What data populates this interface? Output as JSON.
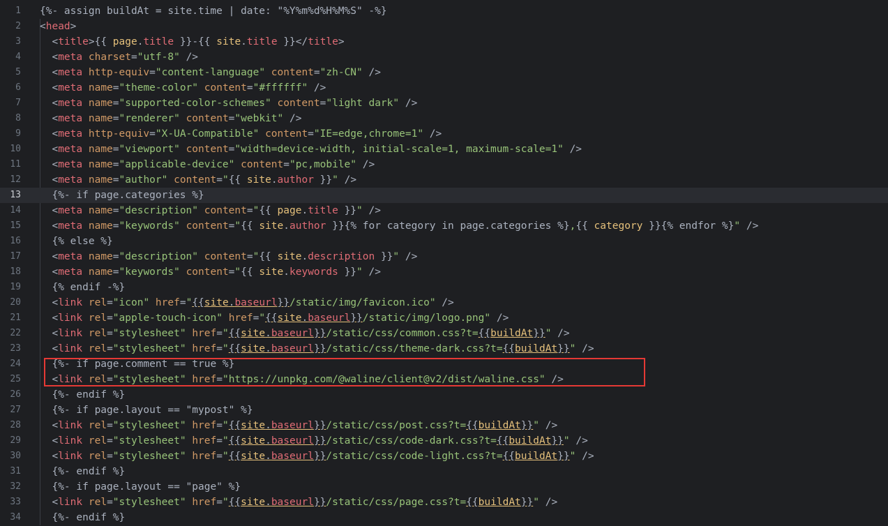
{
  "editor": {
    "current_line": 13,
    "lines": [
      {
        "n": "1",
        "text": "{%- assign buildAt = site.time | date: \"%Y%m%d%H%M%S\" -%}"
      },
      {
        "n": "2",
        "text": "<head>"
      },
      {
        "n": "3",
        "text": "  <title>{{ page.title }}-{{ site.title }}</title>"
      },
      {
        "n": "4",
        "text": "  <meta charset=\"utf-8\" />"
      },
      {
        "n": "5",
        "text": "  <meta http-equiv=\"content-language\" content=\"zh-CN\" />"
      },
      {
        "n": "6",
        "text": "  <meta name=\"theme-color\" content=\"#ffffff\" />"
      },
      {
        "n": "7",
        "text": "  <meta name=\"supported-color-schemes\" content=\"light dark\" />"
      },
      {
        "n": "8",
        "text": "  <meta name=\"renderer\" content=\"webkit\" />"
      },
      {
        "n": "9",
        "text": "  <meta http-equiv=\"X-UA-Compatible\" content=\"IE=edge,chrome=1\" />"
      },
      {
        "n": "10",
        "text": "  <meta name=\"viewport\" content=\"width=device-width, initial-scale=1, maximum-scale=1\" />"
      },
      {
        "n": "11",
        "text": "  <meta name=\"applicable-device\" content=\"pc,mobile\" />"
      },
      {
        "n": "12",
        "text": "  <meta name=\"author\" content=\"{{ site.author }}\" />"
      },
      {
        "n": "13",
        "text": "  {%- if page.categories %}"
      },
      {
        "n": "14",
        "text": "  <meta name=\"description\" content=\"{{ page.title }}\" />"
      },
      {
        "n": "15",
        "text": "  <meta name=\"keywords\" content=\"{{ site.author }}{% for category in page.categories %},{{ category }}{% endfor %}\" />"
      },
      {
        "n": "16",
        "text": "  {% else %}"
      },
      {
        "n": "17",
        "text": "  <meta name=\"description\" content=\"{{ site.description }}\" />"
      },
      {
        "n": "18",
        "text": "  <meta name=\"keywords\" content=\"{{ site.keywords }}\" />"
      },
      {
        "n": "19",
        "text": "  {% endif -%}"
      },
      {
        "n": "20",
        "text": "  <link rel=\"icon\" href=\"{{site.baseurl}}/static/img/favicon.ico\" />"
      },
      {
        "n": "21",
        "text": "  <link rel=\"apple-touch-icon\" href=\"{{site.baseurl}}/static/img/logo.png\" />"
      },
      {
        "n": "22",
        "text": "  <link rel=\"stylesheet\" href=\"{{site.baseurl}}/static/css/common.css?t={{buildAt}}\" />"
      },
      {
        "n": "23",
        "text": "  <link rel=\"stylesheet\" href=\"{{site.baseurl}}/static/css/theme-dark.css?t={{buildAt}}\" />"
      },
      {
        "n": "24",
        "text": "  {%- if page.comment == true %}"
      },
      {
        "n": "25",
        "text": "  <link rel=\"stylesheet\" href=\"https://unpkg.com/@waline/client@v2/dist/waline.css\" />"
      },
      {
        "n": "26",
        "text": "  {%- endif %}"
      },
      {
        "n": "27",
        "text": "  {%- if page.layout == \"mypost\" %}"
      },
      {
        "n": "28",
        "text": "  <link rel=\"stylesheet\" href=\"{{site.baseurl}}/static/css/post.css?t={{buildAt}}\" />"
      },
      {
        "n": "29",
        "text": "  <link rel=\"stylesheet\" href=\"{{site.baseurl}}/static/css/code-dark.css?t={{buildAt}}\" />"
      },
      {
        "n": "30",
        "text": "  <link rel=\"stylesheet\" href=\"{{site.baseurl}}/static/css/code-light.css?t={{buildAt}}\" />"
      },
      {
        "n": "31",
        "text": "  {%- endif %}"
      },
      {
        "n": "32",
        "text": "  {%- if page.layout == \"page\" %}"
      },
      {
        "n": "33",
        "text": "  <link rel=\"stylesheet\" href=\"{{site.baseurl}}/static/css/page.css?t={{buildAt}}\" />"
      },
      {
        "n": "34",
        "text": "  {%- endif %}"
      }
    ]
  },
  "highlight": {
    "color": "#e53935",
    "from_line": 24,
    "to_line": 25
  },
  "colors": {
    "background": "#1e1f22",
    "tag": "#e06c75",
    "attribute": "#d19a66",
    "string": "#98c379",
    "variable": "#e5c07b",
    "text": "#abb2bf"
  }
}
